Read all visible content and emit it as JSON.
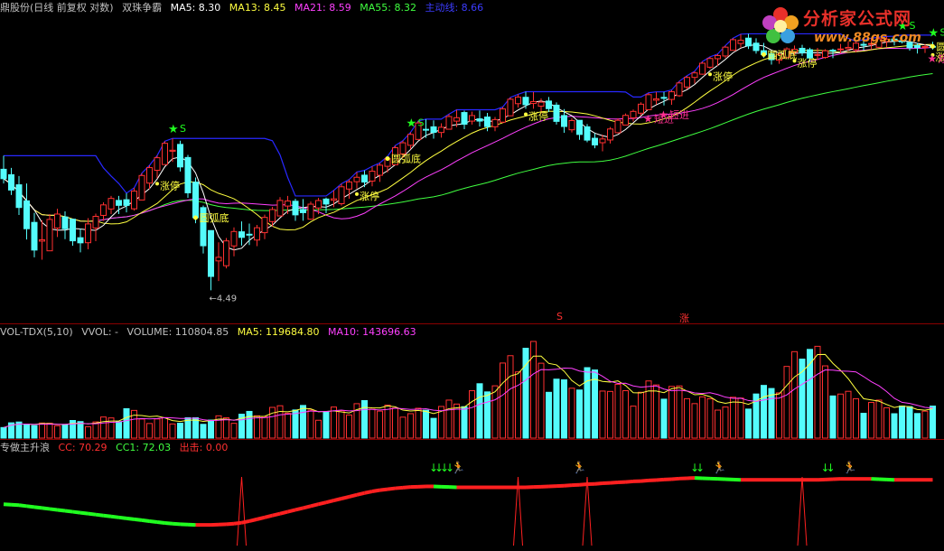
{
  "header_main": {
    "title": "鼎股份(日线 前复权 对数)",
    "indicator": "双珠争霸",
    "ma5": "MA5: 8.30",
    "ma13": "MA13: 8.45",
    "ma21": "MA21: 8.59",
    "ma55": "MA55: 8.32",
    "main_line": "主动线: 8.66"
  },
  "header_vol": {
    "name": "VOL-TDX(5,10)",
    "vvol": "VVOL: -",
    "volume": "VOLUME: 110804.85",
    "ma5": "MA5: 119684.80",
    "ma10": "MA10: 143696.63"
  },
  "header_osc": {
    "name": "专做主升浪",
    "cc": "CC: 70.29",
    "cc1": "CC1: 72.03",
    "out": "出击: 0.00"
  },
  "logo": {
    "title": "分析家公式网",
    "url": "www.88gs.com"
  },
  "colors": {
    "up": "#ff3030",
    "down": "#54fcfc",
    "ma5": "#ffffff",
    "ma13": "#ffff40",
    "ma21": "#ff40ff",
    "ma55": "#40ff40",
    "main_line": "#2828ff",
    "signal": "#ffff40",
    "short": "#ff3090",
    "star": "#20ff20",
    "osc_up": "#ff2020",
    "osc_down": "#20ff20"
  },
  "separator_markers": [
    {
      "label": "S",
      "pos": 620
    },
    {
      "label": "涨",
      "pos": 757
    }
  ],
  "chart_data": [
    {
      "type": "candlestick",
      "price_range": [
        4.2,
        10.9
      ],
      "low_label": "←4.49",
      "candles": [
        [
          6.6,
          6.9,
          6.3,
          6.4
        ],
        [
          6.4,
          6.55,
          6.0,
          6.1
        ],
        [
          6.1,
          6.3,
          5.2,
          5.4
        ],
        [
          5.4,
          5.6,
          4.9,
          5.0
        ],
        [
          5.0,
          5.6,
          4.95,
          5.5
        ],
        [
          5.5,
          5.8,
          5.3,
          5.7
        ],
        [
          5.7,
          5.75,
          5.25,
          5.3
        ],
        [
          5.3,
          5.4,
          5.0,
          5.15
        ],
        [
          5.15,
          5.7,
          5.1,
          5.65
        ],
        [
          5.65,
          5.9,
          5.55,
          5.85
        ],
        [
          5.85,
          6.05,
          5.7,
          6.0
        ],
        [
          6.0,
          6.1,
          5.75,
          5.8
        ],
        [
          5.8,
          6.2,
          5.75,
          6.15
        ],
        [
          6.15,
          6.6,
          6.1,
          6.55
        ],
        [
          6.55,
          6.9,
          6.4,
          6.85
        ],
        [
          6.85,
          7.25,
          6.8,
          7.2
        ],
        [
          7.2,
          7.35,
          6.7,
          6.8
        ],
        [
          6.8,
          6.85,
          5.9,
          6.0
        ],
        [
          6.0,
          6.05,
          5.2,
          5.3
        ],
        [
          5.3,
          5.35,
          4.49,
          4.7
        ],
        [
          4.7,
          5.1,
          4.6,
          5.05
        ],
        [
          5.05,
          5.5,
          5.0,
          5.45
        ],
        [
          5.45,
          5.6,
          5.2,
          5.25
        ],
        [
          5.25,
          5.4,
          5.05,
          5.35
        ],
        [
          5.35,
          5.75,
          5.3,
          5.7
        ],
        [
          5.7,
          5.9,
          5.6,
          5.85
        ],
        [
          5.85,
          6.05,
          5.7,
          5.95
        ],
        [
          5.95,
          6.0,
          5.55,
          5.6
        ],
        [
          5.6,
          5.9,
          5.55,
          5.85
        ],
        [
          5.85,
          6.05,
          5.75,
          6.0
        ],
        [
          6.0,
          6.1,
          5.8,
          5.9
        ],
        [
          5.9,
          6.3,
          5.85,
          6.25
        ],
        [
          6.25,
          6.55,
          6.2,
          6.5
        ],
        [
          6.5,
          6.55,
          6.2,
          6.3
        ],
        [
          6.3,
          6.7,
          6.25,
          6.65
        ],
        [
          6.65,
          6.85,
          6.5,
          6.8
        ],
        [
          6.8,
          7.1,
          6.7,
          7.05
        ],
        [
          7.05,
          7.4,
          7.0,
          7.35
        ],
        [
          7.35,
          7.7,
          7.3,
          7.65
        ],
        [
          7.65,
          7.8,
          7.3,
          7.4
        ],
        [
          7.4,
          7.7,
          7.35,
          7.6
        ],
        [
          7.6,
          7.95,
          7.55,
          7.9
        ],
        [
          7.9,
          8.1,
          7.6,
          7.7
        ],
        [
          7.7,
          7.95,
          7.65,
          7.9
        ],
        [
          7.9,
          8.0,
          7.5,
          7.55
        ],
        [
          7.55,
          7.85,
          7.5,
          7.8
        ],
        [
          7.8,
          8.2,
          7.75,
          8.15
        ],
        [
          8.15,
          8.45,
          8.1,
          8.4
        ],
        [
          8.4,
          8.55,
          8.05,
          8.1
        ],
        [
          8.1,
          8.3,
          7.9,
          8.25
        ],
        [
          8.25,
          8.4,
          8.0,
          8.05
        ],
        [
          8.05,
          8.1,
          7.4,
          7.5
        ],
        [
          7.5,
          7.8,
          7.45,
          7.75
        ],
        [
          7.75,
          7.8,
          7.3,
          7.35
        ],
        [
          7.35,
          7.4,
          7.05,
          7.1
        ],
        [
          7.1,
          7.45,
          7.05,
          7.4
        ],
        [
          7.4,
          7.75,
          7.35,
          7.7
        ],
        [
          7.7,
          7.9,
          7.65,
          7.85
        ],
        [
          7.85,
          8.15,
          7.8,
          8.1
        ],
        [
          8.1,
          8.4,
          8.05,
          8.35
        ],
        [
          8.35,
          8.55,
          8.2,
          8.3
        ],
        [
          8.3,
          8.5,
          8.1,
          8.45
        ],
        [
          8.45,
          8.85,
          8.4,
          8.8
        ],
        [
          8.8,
          9.1,
          8.75,
          9.05
        ],
        [
          9.05,
          9.4,
          9.0,
          9.35
        ],
        [
          9.35,
          9.6,
          9.25,
          9.55
        ],
        [
          9.55,
          9.9,
          9.5,
          9.85
        ],
        [
          9.85,
          10.2,
          9.8,
          10.15
        ],
        [
          10.15,
          10.35,
          9.85,
          9.95
        ],
        [
          9.95,
          10.1,
          9.6,
          9.7
        ],
        [
          9.7,
          9.75,
          9.3,
          9.4
        ],
        [
          9.4,
          9.7,
          9.35,
          9.65
        ],
        [
          9.65,
          9.85,
          9.55,
          9.8
        ],
        [
          9.8,
          9.95,
          9.6,
          9.7
        ],
        [
          9.7,
          9.85,
          9.4,
          9.5
        ],
        [
          9.5,
          9.75,
          9.45,
          9.7
        ],
        [
          9.7,
          9.9,
          9.6,
          9.85
        ],
        [
          9.85,
          10.0,
          9.7,
          9.75
        ],
        [
          9.75,
          10.05,
          9.7,
          10.0
        ],
        [
          10.0,
          10.15,
          9.8,
          9.9
        ],
        [
          9.9,
          10.1,
          9.75,
          10.05
        ],
        [
          10.05,
          10.25,
          9.9,
          10.15
        ],
        [
          10.15,
          10.2,
          9.95,
          10.0
        ],
        [
          10.0,
          10.1,
          9.7,
          9.8
        ],
        [
          9.8,
          9.95,
          9.65,
          9.9
        ],
        [
          9.9,
          10.0,
          9.75,
          9.85
        ]
      ],
      "signals": [
        {
          "label": "涨停",
          "i": 14,
          "kind": "limit"
        },
        {
          "label": "圆弧底",
          "i": 18,
          "kind": "arc"
        },
        {
          "label": "S",
          "i": 16,
          "kind": "star"
        },
        {
          "label": "涨停",
          "i": 33,
          "kind": "limit"
        },
        {
          "label": "圆弧底",
          "i": 36,
          "kind": "arc"
        },
        {
          "label": "S",
          "i": 38,
          "kind": "star"
        },
        {
          "label": "涨停",
          "i": 49,
          "kind": "limit"
        },
        {
          "label": "短进",
          "i": 60,
          "kind": "short"
        },
        {
          "label": "短进",
          "i": 62,
          "kind": "short"
        },
        {
          "label": "涨停",
          "i": 66,
          "kind": "limit"
        },
        {
          "label": "圆弧底",
          "i": 71,
          "kind": "arc"
        },
        {
          "label": "涨停",
          "i": 74,
          "kind": "limit"
        },
        {
          "label": "S",
          "i": 84,
          "kind": "star"
        },
        {
          "label": "S",
          "i": 88,
          "kind": "star"
        },
        {
          "label": "涨停",
          "i": 92,
          "kind": "limit"
        },
        {
          "label": "圆弧底",
          "i": 107,
          "kind": "arc"
        },
        {
          "label": "短进",
          "i": 118,
          "kind": "short"
        }
      ]
    },
    {
      "type": "bar",
      "title": "VOLUME",
      "volume_range": [
        0,
        420000
      ],
      "volumes": [
        60000,
        58000,
        55000,
        57000,
        62000,
        54000,
        52000,
        56000,
        59000,
        61000,
        60000,
        58000,
        65000,
        72000,
        78000,
        90000,
        110000,
        95000,
        80000,
        70000,
        68000,
        72000,
        66000,
        64000,
        70000,
        75000,
        73000,
        71000,
        76000,
        80000,
        78000,
        82000,
        88000,
        92000,
        96000,
        100000,
        108000,
        115000,
        120000,
        118000,
        112000,
        105000,
        98000,
        102000,
        106000,
        110000,
        118000,
        125000,
        130000,
        128000,
        122000,
        115000,
        108000,
        104000,
        100000,
        102000,
        106000,
        112000,
        120000,
        130000,
        140000,
        155000,
        170000,
        190000,
        210000,
        230000,
        260000,
        300000,
        340000,
        360000,
        330000,
        290000,
        250000,
        220000,
        200000,
        210000,
        230000,
        250000,
        240000,
        220000,
        200000,
        185000,
        175000,
        170000,
        180000,
        195000,
        210000,
        205000,
        190000,
        180000,
        170000,
        160000,
        150000,
        145000,
        140000,
        135000,
        130000,
        140000,
        150000,
        160000,
        170000,
        180000,
        200000,
        230000,
        260000,
        300000,
        350000,
        400000,
        320000,
        260000,
        210000,
        180000,
        160000,
        150000,
        140000,
        135000,
        130000,
        125000,
        120000,
        115000,
        110000,
        112000,
        118000,
        110804
      ]
    },
    {
      "type": "line",
      "title": "专做主升浪",
      "cc_range": [
        0,
        100
      ],
      "cc": [
        44,
        43,
        42,
        41,
        40,
        39,
        38,
        37,
        36,
        35,
        34,
        33,
        32,
        31,
        30,
        29,
        28,
        27,
        26,
        25,
        24,
        23,
        23,
        22,
        22,
        22,
        22,
        22,
        23,
        23,
        24,
        25,
        26,
        28,
        30,
        32,
        34,
        36,
        38,
        40,
        42,
        44,
        46,
        48,
        50,
        52,
        54,
        56,
        58,
        59,
        60,
        61,
        62,
        62,
        63,
        63,
        63,
        63,
        62,
        62,
        62,
        62,
        62,
        62,
        62,
        62,
        62,
        62,
        62,
        62,
        63,
        63,
        63,
        64,
        64,
        65,
        65,
        66,
        66,
        67,
        67,
        68,
        68,
        69,
        69,
        70,
        70,
        71,
        71,
        72,
        72,
        72,
        72,
        71,
        71,
        71,
        70,
        70,
        70,
        70,
        70,
        70,
        70,
        70,
        70,
        70,
        70,
        70,
        70,
        71,
        71,
        71,
        71,
        71,
        71,
        71,
        70,
        70,
        70,
        70,
        70,
        70,
        70,
        70
      ]
    }
  ]
}
